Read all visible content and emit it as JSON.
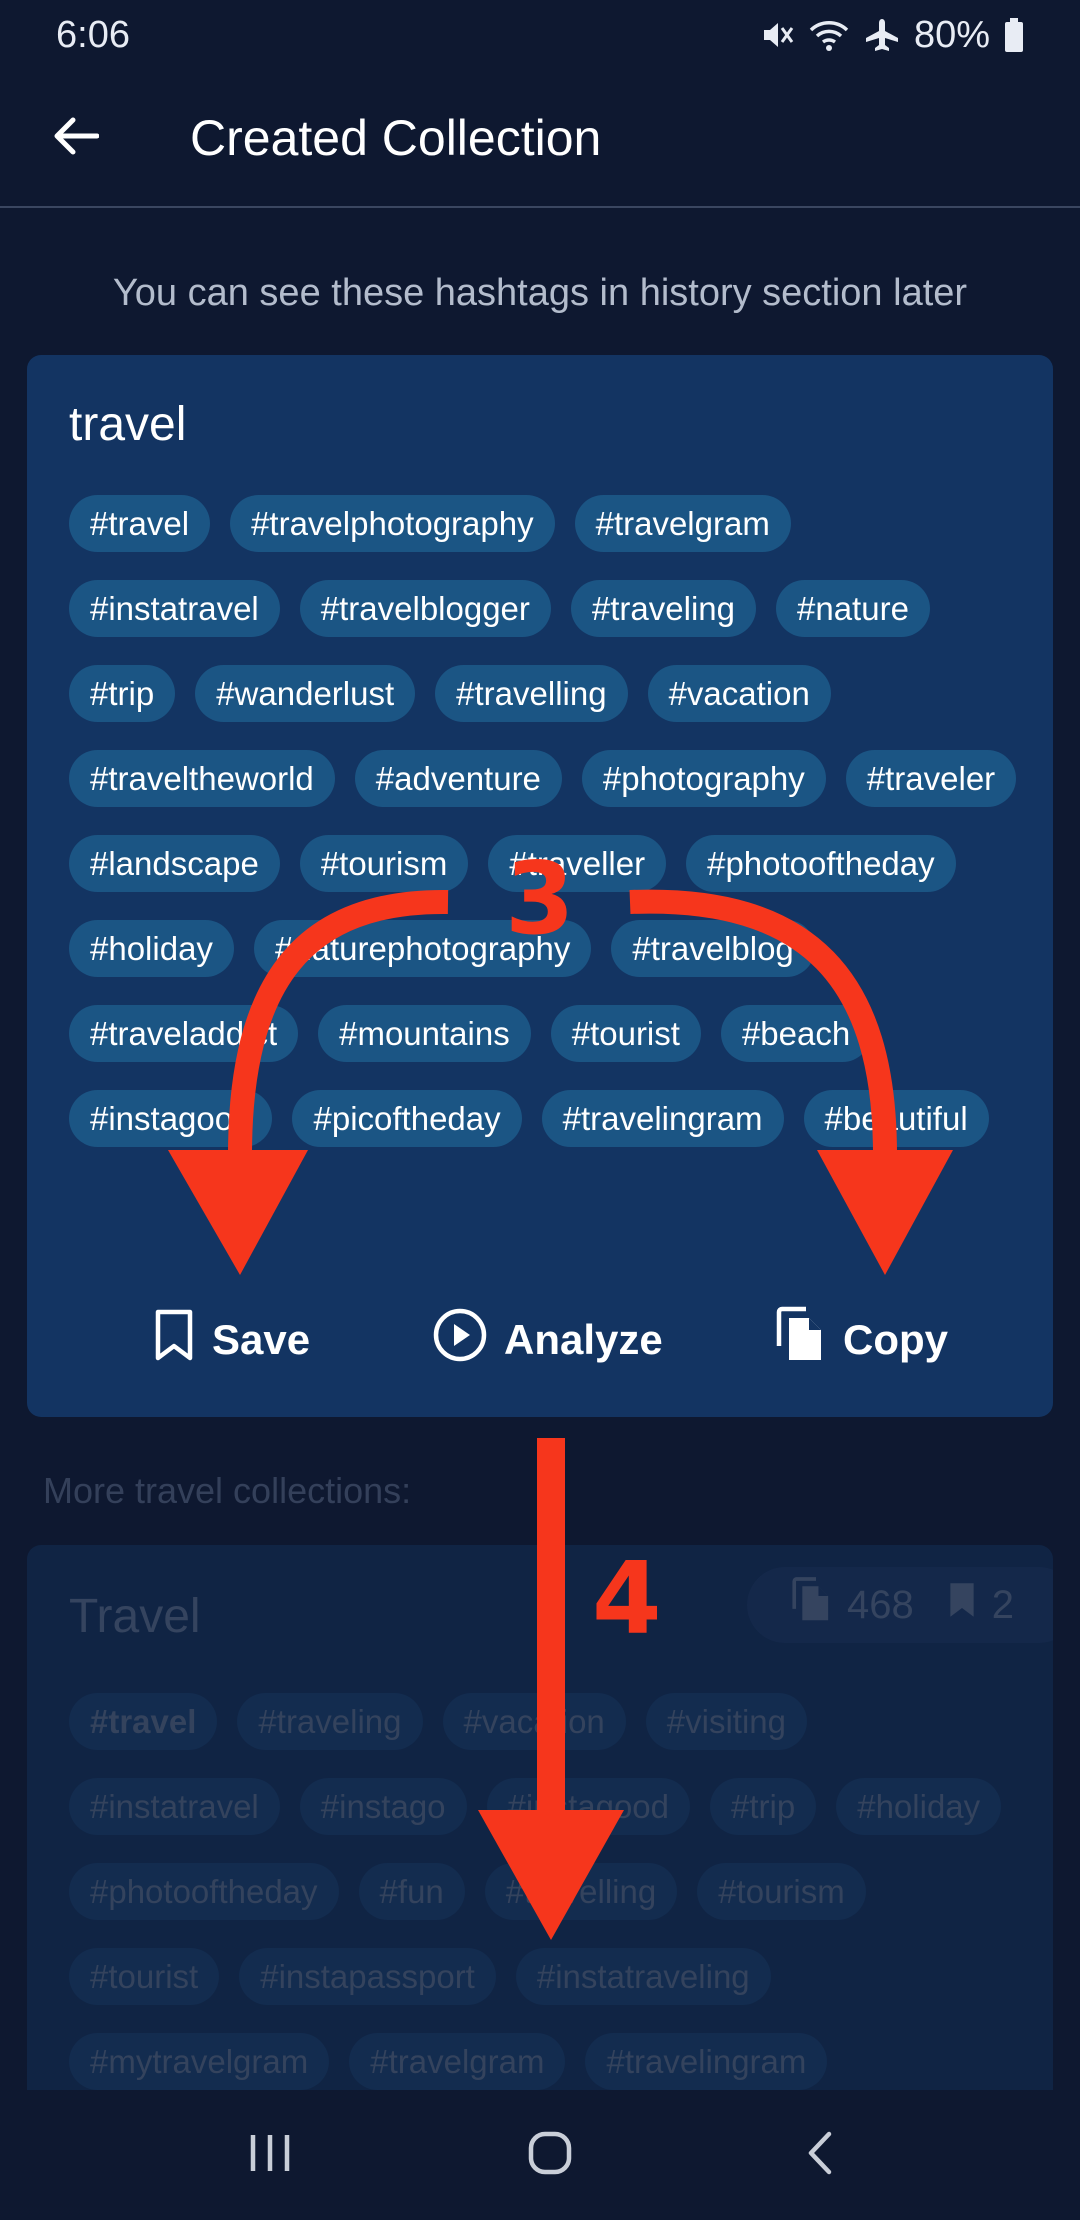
{
  "status_bar": {
    "time": "6:06",
    "battery": "80%"
  },
  "app_bar": {
    "title": "Created Collection"
  },
  "hint": "You can see these hashtags in history section later",
  "collection": {
    "title": "travel",
    "tags": [
      "#travel",
      "#travelphotography",
      "#travelgram",
      "#instatravel",
      "#travelblogger",
      "#traveling",
      "#nature",
      "#trip",
      "#wanderlust",
      "#travelling",
      "#vacation",
      "#traveltheworld",
      "#adventure",
      "#photography",
      "#traveler",
      "#landscape",
      "#tourism",
      "#traveller",
      "#photooftheday",
      "#holiday",
      "#naturephotography",
      "#travelblog",
      "#traveladdict",
      "#mountains",
      "#tourist",
      "#beach",
      "#instagood",
      "#picoftheday",
      "#travelingram",
      "#beautiful"
    ],
    "actions": {
      "save": "Save",
      "analyze": "Analyze",
      "copy": "Copy"
    }
  },
  "more_label": "More travel collections:",
  "related": {
    "title": "Travel",
    "copies": "468",
    "saves": "2",
    "tags": [
      "#travel",
      "#traveling",
      "#vacation",
      "#visiting",
      "#instatravel",
      "#instago",
      "#instagood",
      "#trip",
      "#holiday",
      "#photooftheday",
      "#fun",
      "#travelling",
      "#tourism",
      "#tourist",
      "#instapassport",
      "#instatraveling",
      "#mytravelgram",
      "#travelgram",
      "#travelingram"
    ]
  },
  "annotations": {
    "step3": "3",
    "step4": "4",
    "color": "#f6361c"
  },
  "colors": {
    "background": "#0e1830",
    "card": "#133462",
    "tag": "#1b5584"
  }
}
